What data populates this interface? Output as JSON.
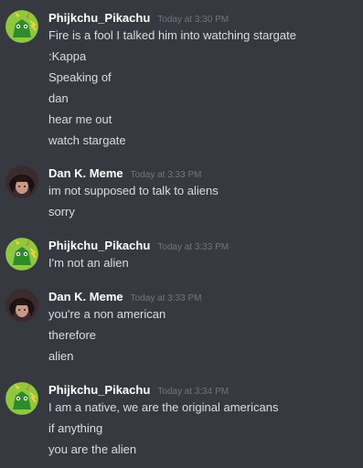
{
  "messages": [
    {
      "author": "Phijkchu_Pikachu",
      "avatar": "pikachu-avatar-icon",
      "time": "Today at 3:30 PM",
      "lines": [
        "Fire is a fool I talked him into watching stargate",
        ":Kappa",
        "Speaking of",
        "dan",
        "hear me out",
        "watch stargate"
      ]
    },
    {
      "author": "Dan K. Meme",
      "avatar": "dark-hair-avatar-icon",
      "time": "Today at 3:33 PM",
      "lines": [
        "im not supposed to talk to aliens",
        "sorry"
      ]
    },
    {
      "author": "Phijkchu_Pikachu",
      "avatar": "pikachu-avatar-icon",
      "time": "Today at 3:33 PM",
      "lines": [
        "I'm not an alien"
      ]
    },
    {
      "author": "Dan K. Meme",
      "avatar": "dark-hair-avatar-icon",
      "time": "Today at 3:33 PM",
      "lines": [
        "you're a non american",
        "therefore",
        "alien"
      ]
    },
    {
      "author": "Phijkchu_Pikachu",
      "avatar": "pikachu-avatar-icon",
      "time": "Today at 3:34 PM",
      "lines": [
        "I am a native, we are the original americans",
        "if anything",
        "you are the alien"
      ]
    }
  ],
  "colors": {
    "background": "#36393f",
    "username": "#ffffff",
    "timestamp": "#72767d",
    "text": "#dcddde",
    "pikachu_avatar_bg": "#8fc83f",
    "dan_avatar_bg": "#3a2b2c"
  }
}
